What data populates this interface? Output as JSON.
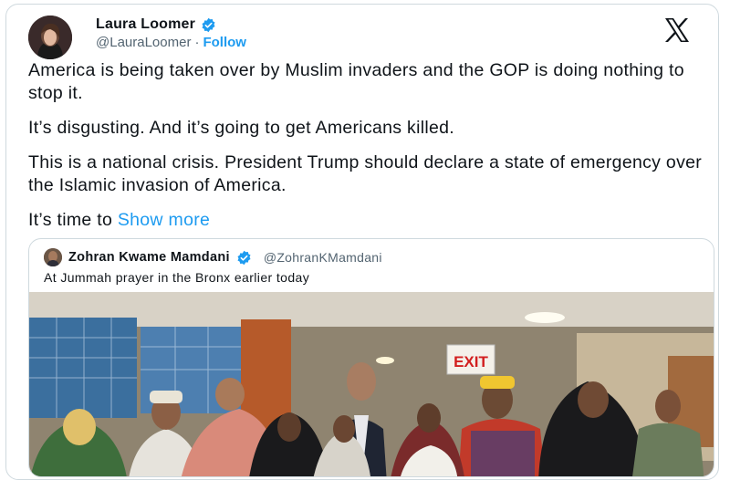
{
  "tweet": {
    "author_name": "Laura Loomer",
    "author_handle": "@LauraLoomer",
    "separator": "·",
    "follow_label": "Follow",
    "paragraphs": [
      "America is being taken over by Muslim invaders and the GOP is doing nothing to stop it.",
      "It’s disgusting. And it’s going to get Americans killed.",
      "This is a national crisis. President Trump should declare a state of emergency over the Islamic invasion of America."
    ],
    "truncated_text": "It’s time to ",
    "show_more_label": "Show more"
  },
  "quoted": {
    "author_name": "Zohran Kwame Mamdani",
    "author_handle": "@ZohranKMamdani",
    "text": "At Jummah prayer in the Bronx earlier today",
    "photo_sign_text": "EXIT"
  },
  "icons": {
    "verified": "verified-badge-icon",
    "platform": "x-logo-icon"
  },
  "colors": {
    "link": "#1d9bf0",
    "text": "#0f1419",
    "secondary": "#536471",
    "border": "#cfd9de",
    "exit_sign": "#d21f1f"
  }
}
